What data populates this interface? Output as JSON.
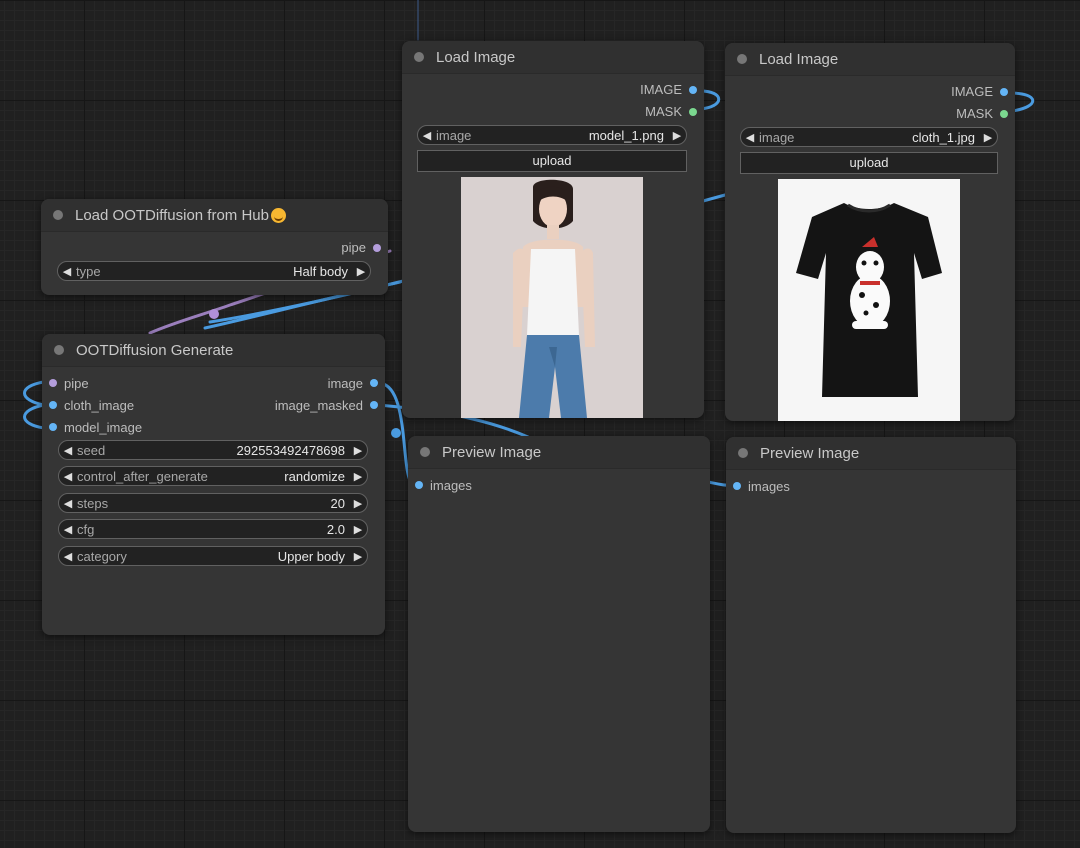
{
  "nodes": {
    "load_image_1": {
      "title": "Load Image",
      "outputs": [
        "IMAGE",
        "MASK"
      ],
      "image_widget": {
        "label": "image",
        "value": "model_1.png"
      },
      "upload_label": "upload"
    },
    "load_image_2": {
      "title": "Load Image",
      "outputs": [
        "IMAGE",
        "MASK"
      ],
      "image_widget": {
        "label": "image",
        "value": "cloth_1.jpg"
      },
      "upload_label": "upload"
    },
    "load_ootd": {
      "title": "Load OOTDiffusion from Hub",
      "outputs": [
        "pipe"
      ],
      "type_widget": {
        "label": "type",
        "value": "Half body"
      }
    },
    "ootd_generate": {
      "title": "OOTDiffusion Generate",
      "inputs": [
        "pipe",
        "cloth_image",
        "model_image"
      ],
      "outputs": [
        "image",
        "image_masked"
      ],
      "widgets": [
        {
          "label": "seed",
          "value": "292553492478698"
        },
        {
          "label": "control_after_generate",
          "value": "randomize"
        },
        {
          "label": "steps",
          "value": "20"
        },
        {
          "label": "cfg",
          "value": "2.0"
        },
        {
          "label": "category",
          "value": "Upper body"
        }
      ]
    },
    "preview_1": {
      "title": "Preview Image",
      "inputs": [
        "images"
      ]
    },
    "preview_2": {
      "title": "Preview Image",
      "inputs": [
        "images"
      ]
    }
  },
  "colors": {
    "image_slot": "#64b5f6",
    "mask_slot": "#7bd88f",
    "pipe_slot": "#b39ddb",
    "link_blue": "#4a9be0",
    "link_purple": "#b08fd8"
  },
  "icons": {
    "collapse": "collapse-dot-icon",
    "hub_emoji": "hugging-face-emoji-icon",
    "prev": "triangle-left-icon",
    "next": "triangle-right-icon"
  }
}
